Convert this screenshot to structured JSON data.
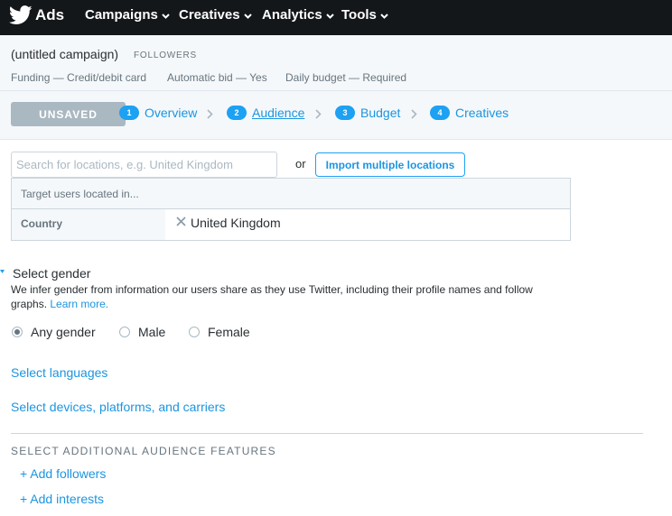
{
  "brand": {
    "name": "Ads"
  },
  "nav": [
    {
      "label": "Campaigns"
    },
    {
      "label": "Creatives"
    },
    {
      "label": "Analytics"
    },
    {
      "label": "Tools"
    }
  ],
  "campaign": {
    "name": "(untitled campaign)",
    "type": "FOLLOWERS",
    "funding": "Funding — Credit/debit card",
    "bid": "Automatic bid — Yes",
    "budget": "Daily budget — Required"
  },
  "steps_bar": {
    "status_label": "UNSAVED",
    "steps": [
      {
        "num": "1",
        "label": "Overview"
      },
      {
        "num": "2",
        "label": "Audience",
        "active": true
      },
      {
        "num": "3",
        "label": "Budget"
      },
      {
        "num": "4",
        "label": "Creatives"
      }
    ]
  },
  "location": {
    "search_placeholder": "Search for locations, e.g. United Kingdom",
    "or_text": "or",
    "import_label": "Import multiple locations",
    "target_header": "Target users located in...",
    "row_label": "Country",
    "row_value": "United Kingdom"
  },
  "gender": {
    "title": "Select gender",
    "description": "We infer gender from information our users share as they use Twitter, including their profile names and follow graphs.",
    "learn_more": "Learn more.",
    "options": [
      {
        "label": "Any gender",
        "checked": true
      },
      {
        "label": "Male",
        "checked": false
      },
      {
        "label": "Female",
        "checked": false
      }
    ]
  },
  "links": {
    "languages": "Select languages",
    "devices": "Select devices, platforms, and carriers"
  },
  "additional": {
    "heading": "SELECT ADDITIONAL AUDIENCE FEATURES",
    "add_followers": "+ Add followers",
    "add_interests": "+ Add interests"
  },
  "colors": {
    "nav_bg": "#14171a",
    "accent": "#1da1f2",
    "link": "#1b95e0",
    "unsaved_bg": "#aab8c2"
  }
}
